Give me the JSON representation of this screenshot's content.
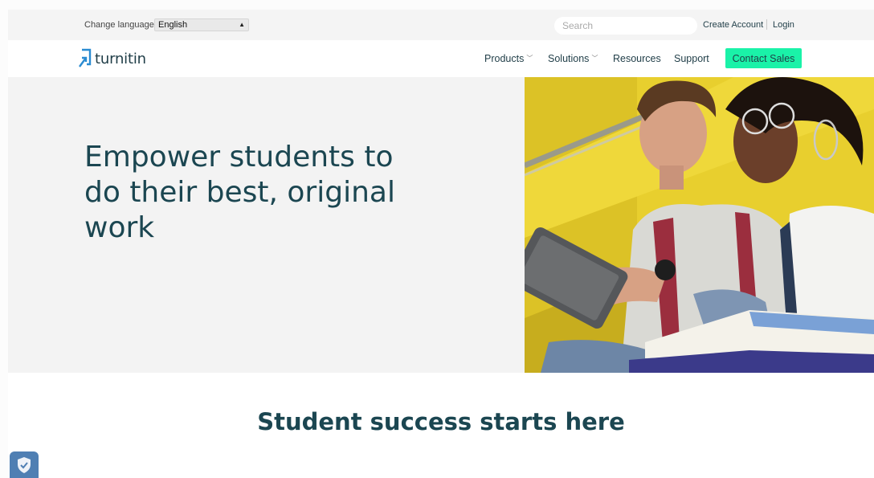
{
  "utility_bar": {
    "change_language_label": "Change language",
    "language_selected": "English",
    "search_placeholder": "Search",
    "create_account": "Create Account",
    "login": "Login"
  },
  "nav": {
    "logo_text": "turnitin",
    "items": [
      {
        "label": "Products",
        "has_dropdown": true
      },
      {
        "label": "Solutions",
        "has_dropdown": true
      },
      {
        "label": "Resources",
        "has_dropdown": false
      },
      {
        "label": "Support",
        "has_dropdown": false
      }
    ],
    "contact_sales": "Contact Sales"
  },
  "hero": {
    "title": "Empower students to do their best, original work"
  },
  "section": {
    "title": "Student success starts here"
  },
  "colors": {
    "brand_dark": "#1b4651",
    "accent_green": "#1af2a8",
    "hero_bg": "#f3f3f3",
    "badge_blue": "#4f7fb3"
  }
}
